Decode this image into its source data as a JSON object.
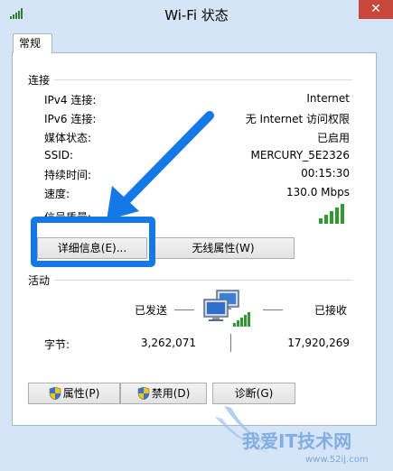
{
  "window": {
    "title": "Wi-Fi 状态",
    "close_glyph": "✕"
  },
  "tab": {
    "label": "常规"
  },
  "connection": {
    "section_title": "连接",
    "rows": [
      {
        "label": "IPv4 连接:",
        "value": "Internet"
      },
      {
        "label": "IPv6 连接:",
        "value": "无 Internet 访问权限"
      },
      {
        "label": "媒体状态:",
        "value": "已启用"
      },
      {
        "label": "SSID:",
        "value": "MERCURY_5E2326"
      },
      {
        "label": "持续时间:",
        "value": "00:15:30"
      },
      {
        "label": "速度:",
        "value": "130.0 Mbps"
      }
    ],
    "signal_label": "信号质量:",
    "signal_bars_filled": 5,
    "signal_bars_total": 5
  },
  "buttons": {
    "details": "详细信息(E)...",
    "wireless_props": "无线属性(W)",
    "properties": "属性(P)",
    "disable": "禁用(D)",
    "diagnose": "诊断(G)"
  },
  "activity": {
    "section_title": "活动",
    "sent_label": "已发送",
    "received_label": "已接收",
    "bytes_label": "字节:",
    "bytes_sent": "3,262,071",
    "bytes_received": "17,920,269"
  },
  "watermark": {
    "text": "我爱IT技术网",
    "url": "www.52ij.com"
  },
  "colors": {
    "accent_blue": "#1479e6",
    "signal_green": "#2f9a2f",
    "close_red": "#c7473b"
  }
}
